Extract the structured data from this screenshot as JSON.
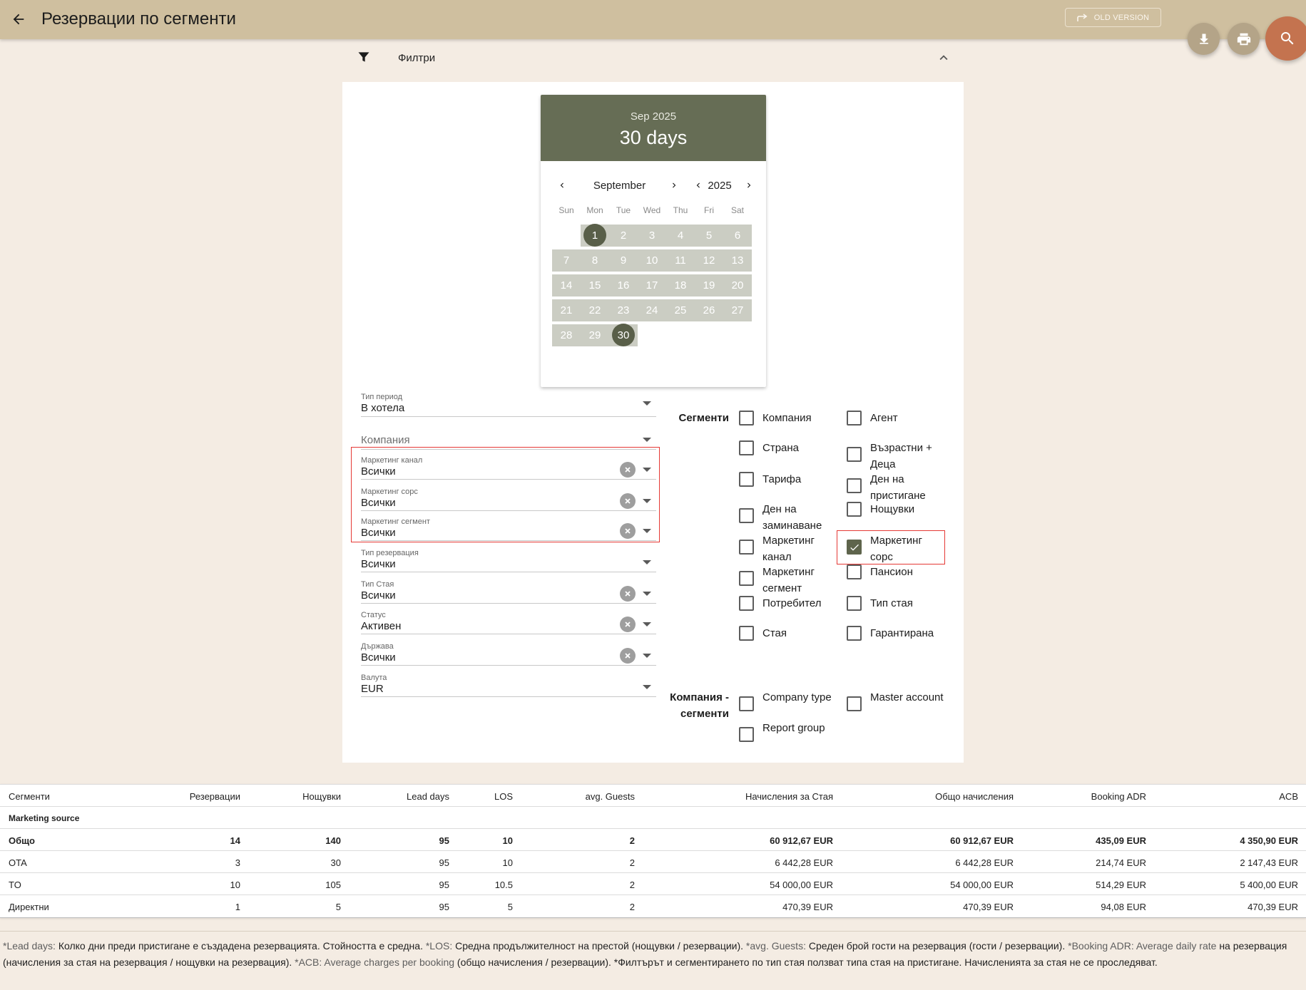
{
  "header": {
    "title": "Резервации по сегменти",
    "old_version_label": "OLD VERSION"
  },
  "filters": {
    "label": "Филтри"
  },
  "calendar": {
    "header_month": "Sep 2025",
    "header_range": "30 days",
    "nav_month": "September",
    "nav_year": "2025",
    "weekdays": [
      "Sun",
      "Mon",
      "Tue",
      "Wed",
      "Thu",
      "Fri",
      "Sat"
    ],
    "first_weekday_index": 1,
    "days_in_month": 30,
    "range_start": 1,
    "range_end": 30
  },
  "form": {
    "period_type": {
      "label": "Тип период",
      "value": "В хотела"
    },
    "company": {
      "placeholder": "Компания"
    },
    "marketing_channel": {
      "label": "Маркетинг канал",
      "value": "Всички"
    },
    "marketing_source": {
      "label": "Маркетинг сорс",
      "value": "Всички"
    },
    "marketing_segment": {
      "label": "Маркетинг сегмент",
      "value": "Всички"
    },
    "reservation_type": {
      "label": "Тип резервация",
      "value": "Всички"
    },
    "room_type": {
      "label": "Тип Стая",
      "value": "Всички"
    },
    "status": {
      "label": "Статус",
      "value": "Активен"
    },
    "country": {
      "label": "Държава",
      "value": "Всички"
    },
    "currency": {
      "label": "Валута",
      "value": "EUR"
    }
  },
  "segments": {
    "title": "Сегменти",
    "col1": [
      "Компания",
      "Страна",
      "Тарифа",
      "Ден на заминаване",
      "Маркетинг канал",
      "Маркетинг сегмент",
      "Потребител",
      "Стая"
    ],
    "col2": [
      "Агент",
      "Възрастни + Деца",
      "Ден на пристигане",
      "Нощувки",
      "Маркетинг сорс",
      "Пансион",
      "Тип стая",
      "Гарантирана"
    ],
    "checked": "Маркетинг сорс"
  },
  "company_segments": {
    "title": "Компания - сегменти",
    "items": [
      "Company type",
      "Master account",
      "Report group"
    ]
  },
  "table": {
    "columns": [
      "Сегменти",
      "Резервации",
      "Нощувки",
      "Lead days",
      "LOS",
      "avg. Guests",
      "Начисления за Стая",
      "Общо начисления",
      "Booking ADR",
      "ACB"
    ],
    "group_label": "Marketing source",
    "rows": [
      [
        "Общо",
        "14",
        "140",
        "95",
        "10",
        "2",
        "60 912,67 EUR",
        "60 912,67 EUR",
        "435,09 EUR",
        "4 350,90 EUR"
      ],
      [
        "OTA",
        "3",
        "30",
        "95",
        "10",
        "2",
        "6 442,28 EUR",
        "6 442,28 EUR",
        "214,74 EUR",
        "2 147,43 EUR"
      ],
      [
        "TO",
        "10",
        "105",
        "95",
        "10.5",
        "2",
        "54 000,00 EUR",
        "54 000,00 EUR",
        "514,29 EUR",
        "5 400,00 EUR"
      ],
      [
        "Директни",
        "1",
        "5",
        "95",
        "5",
        "2",
        "470,39 EUR",
        "470,39 EUR",
        "94,08 EUR",
        "470,39 EUR"
      ]
    ]
  },
  "footnote": {
    "parts": [
      {
        "t": "*Lead days: ",
        "m": true
      },
      {
        "t": "Колко дни преди пристигане е създадена резервацията. Стойността е средна.",
        "m": false
      },
      {
        "t": " *LOS: ",
        "m": true
      },
      {
        "t": "Средна продължителност на престой (нощувки / резервации).",
        "m": false
      },
      {
        "t": " *avg. Guests: ",
        "m": true
      },
      {
        "t": "Среден брой гости на резервация (гости / резервации).",
        "m": false
      },
      {
        "t": " *Booking ADR: Average daily rate ",
        "m": true
      },
      {
        "t": "на резервация (начисления за стая на резервация / нощувки на резервация).",
        "m": false
      },
      {
        "t": " *ACB: Average charges per booking ",
        "m": true
      },
      {
        "t": "(общо начисления / резервации). *Филтърът и сегментирането по тип стая ползват типа стая на пристигане. Начисленията за стая не се проследяват.",
        "m": false
      }
    ]
  }
}
